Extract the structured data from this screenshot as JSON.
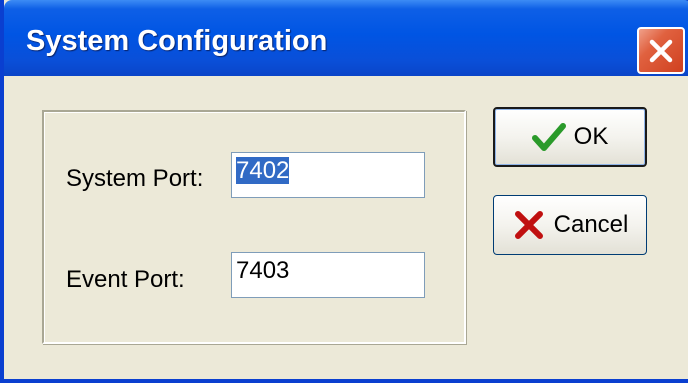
{
  "window": {
    "title": "System Configuration"
  },
  "title_bar": {
    "close_icon": "close-x-icon"
  },
  "form": {
    "system_port_label": "System Port:",
    "system_port_value": "7402",
    "event_port_label": "Event Port:",
    "event_port_value": "7403"
  },
  "buttons": {
    "ok_label": "OK",
    "ok_icon": "checkmark-icon",
    "cancel_label": "Cancel",
    "cancel_icon": "x-mark-icon"
  },
  "colors": {
    "titlebar": "#0055e4",
    "close_button": "#e0613f",
    "selection": "#316ac5",
    "ok_check": "#2a9a2a",
    "cancel_x": "#c01010"
  }
}
